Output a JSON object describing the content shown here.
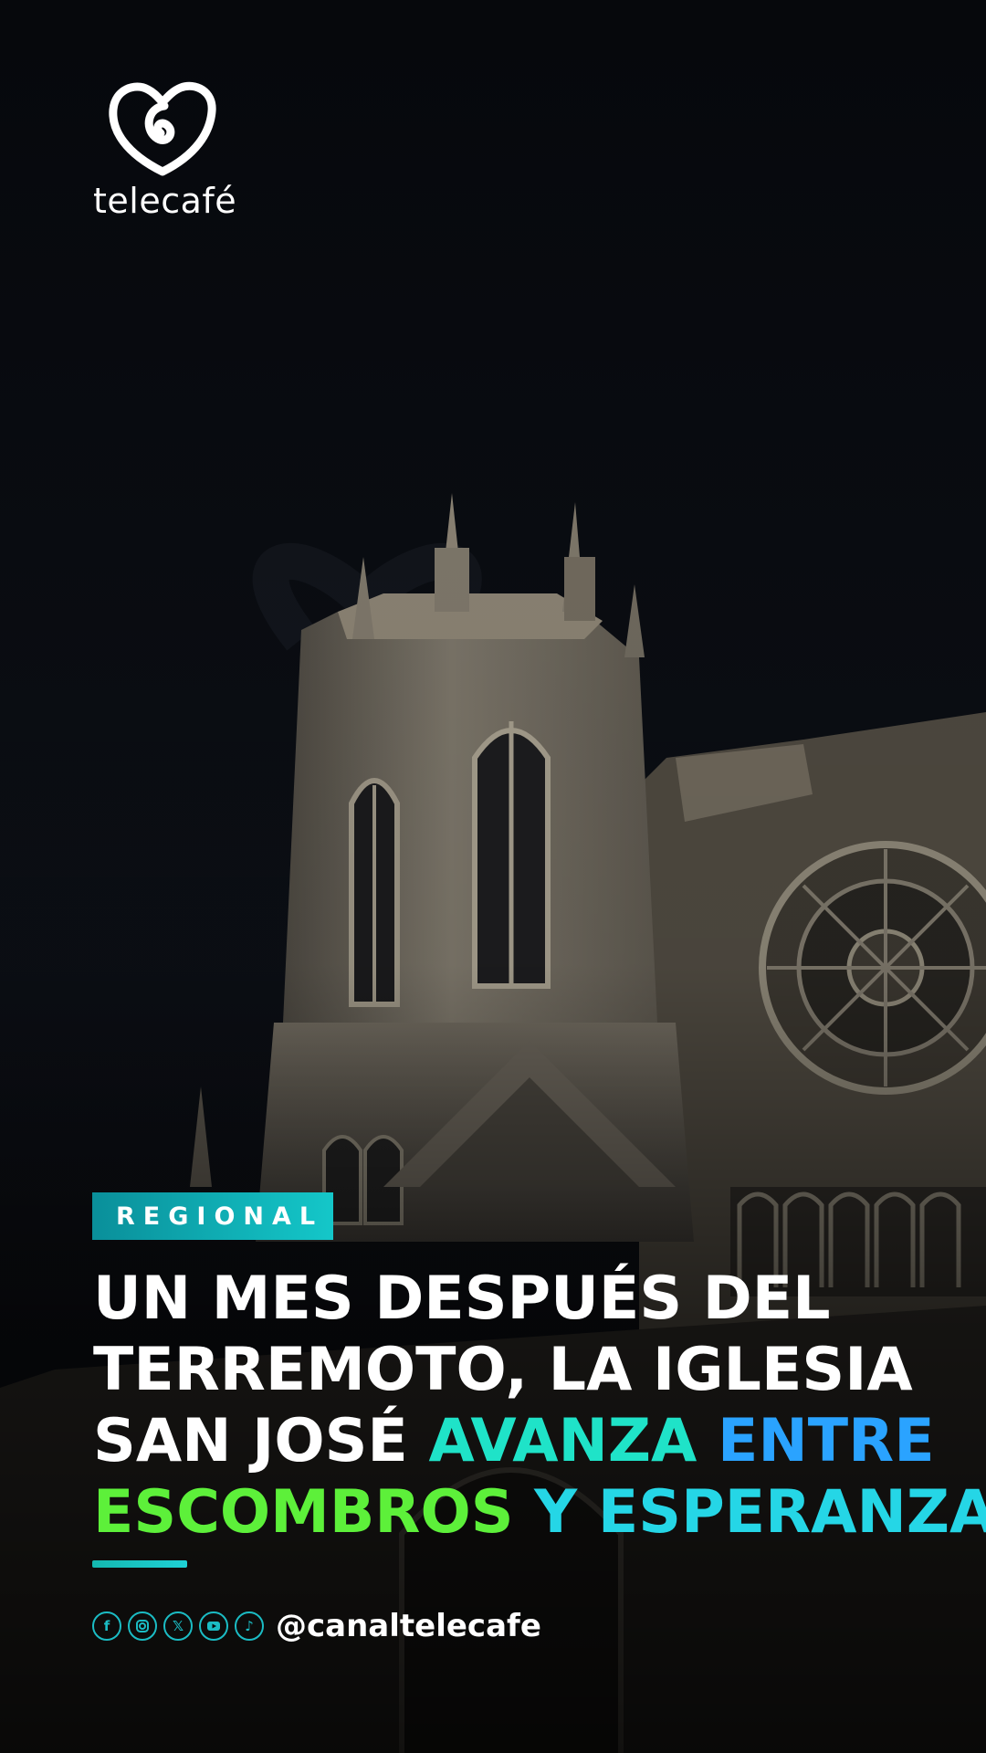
{
  "brand": {
    "name": "telecafé"
  },
  "story": {
    "category": "REGIONAL",
    "headline": {
      "line1": "UN MES DESPUÉS DEL",
      "line2": "TERREMOTO, LA IGLESIA",
      "line3_white": "SAN JOSÉ ",
      "line3_accent1": "AVANZA ",
      "line3_accent2": "ENTRE",
      "line4_accent1": "ESCOMBROS ",
      "line4_accent2": "Y ESPERANZA"
    }
  },
  "footer": {
    "social_icons": [
      "facebook-icon",
      "instagram-icon",
      "x-icon",
      "youtube-icon",
      "tiktok-icon"
    ],
    "handle": "@canaltelecafe"
  },
  "colors": {
    "background": "#07090d",
    "tag_start": "#0a8f9a",
    "tag_end": "#14c7c9",
    "accent_teal": "#1fe3c8",
    "accent_blue": "#2aa3ff",
    "accent_green": "#5df03a",
    "accent_cyan": "#25d6e6"
  }
}
